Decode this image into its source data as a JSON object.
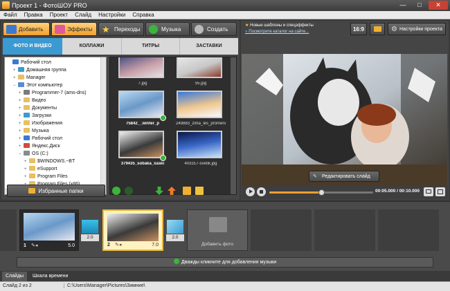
{
  "window": {
    "title": "Проект 1 - ФотоШОУ PRO",
    "min_glyph": "—",
    "max_glyph": "□",
    "close_glyph": "✕"
  },
  "menu": [
    "Файл",
    "Правка",
    "Проект",
    "Слайд",
    "Настройки",
    "Справка"
  ],
  "main_tabs": [
    {
      "label": "Добавить",
      "icon": "photos-icon",
      "active": true
    },
    {
      "label": "Эффекты",
      "icon": "magic-wand-icon",
      "active": true
    },
    {
      "label": "Переходы",
      "icon": "star-icon",
      "active": false
    },
    {
      "label": "Музыка",
      "icon": "music-note-icon",
      "active": false
    },
    {
      "label": "Создать",
      "icon": "film-reel-icon",
      "active": false
    }
  ],
  "sub_tabs": [
    "ФОТО И ВИДЕО",
    "КОЛЛАЖИ",
    "ТИТРЫ",
    "ЗАСТАВКИ"
  ],
  "tree": [
    {
      "label": "Рабочий стол",
      "level": 0,
      "exp": "",
      "color": "#3c7ad2"
    },
    {
      "label": "Домашняя группа",
      "level": 1,
      "exp": "+",
      "color": "#3c9ad2"
    },
    {
      "label": "Manager",
      "level": 1,
      "exp": "+",
      "color": "#e8c060"
    },
    {
      "label": "Этот компьютер",
      "level": 1,
      "exp": "−",
      "color": "#5a8ad2"
    },
    {
      "label": "Programmer-7 (ams-dns)",
      "level": 2,
      "exp": "+",
      "color": "#7a7a7a"
    },
    {
      "label": "Видео",
      "level": 2,
      "exp": "+",
      "color": "#e8c060"
    },
    {
      "label": "Документы",
      "level": 2,
      "exp": "+",
      "color": "#e8c060"
    },
    {
      "label": "Загрузки",
      "level": 2,
      "exp": "+",
      "color": "#3c9ad2"
    },
    {
      "label": "Изображения",
      "level": 2,
      "exp": "+",
      "color": "#e8c060"
    },
    {
      "label": "Музыка",
      "level": 2,
      "exp": "+",
      "color": "#e8c060"
    },
    {
      "label": "Рабочий стол",
      "level": 2,
      "exp": "+",
      "color": "#3c7ad2"
    },
    {
      "label": "Яндекс.Диск",
      "level": 2,
      "exp": "+",
      "color": "#d24a3c"
    },
    {
      "label": "OS (C:)",
      "level": 2,
      "exp": "−",
      "color": "#8a8a8a"
    },
    {
      "label": "$WINDOWS.~BT",
      "level": 3,
      "exp": "+",
      "color": "#e8c060"
    },
    {
      "label": "eSupport",
      "level": 3,
      "exp": "+",
      "color": "#e8c060"
    },
    {
      "label": "Program Files",
      "level": 3,
      "exp": "+",
      "color": "#e8c060"
    },
    {
      "label": "Program Files (x86)",
      "level": 3,
      "exp": "+",
      "color": "#e8c060"
    }
  ],
  "thumbnails": [
    {
      "caption": "7.jpg",
      "bold": false,
      "checked": false,
      "bg": "linear-gradient(160deg,#2a3a78,#c8a0a8 60%,#e8e0e8)"
    },
    {
      "caption": "55.jpg",
      "bold": false,
      "checked": false,
      "bg": "linear-gradient(160deg,#f0f0f0,#c8c8c8 60%,#8a3a2a)"
    },
    {
      "caption": "75842__winter_p",
      "bold": true,
      "checked": true,
      "bg": "linear-gradient(160deg,#b8d8f0,#6a98c8 50%,#e8e8f0)"
    },
    {
      "caption": "249883_zima_les_promeni",
      "bold": false,
      "checked": false,
      "bg": "linear-gradient(170deg,#3a78d8,#f0c890 55%,#f8f8ff)"
    },
    {
      "caption": "379435_sobaka_xaski",
      "bold": true,
      "checked": true,
      "bg": "linear-gradient(160deg,#f0f0f0,#3a3a3a 55%,#c89060)"
    },
    {
      "caption": "403317-svetik.jpg",
      "bold": false,
      "checked": false,
      "bg": "linear-gradient(170deg,#0a1848,#3a68c8 50%,#c8e0f8)"
    }
  ],
  "favorites_button": "Избранные папки",
  "news": {
    "line1": "Новые шаблоны и спецэффекты",
    "line2": "Посмотрите каталог на сайте..."
  },
  "aspect_ratio": "16:9",
  "settings_button": "Настройки проекта",
  "edit_slide_button": "Редактировать слайд",
  "player": {
    "time": "00:05.000 / 00:10.000",
    "progress": 0.5
  },
  "slides": [
    {
      "num": "1",
      "duration": "5.0",
      "selected": false
    },
    {
      "num": "2",
      "duration": "7.0",
      "selected": true
    }
  ],
  "transitions": [
    {
      "duration": "2.0"
    },
    {
      "duration": "2.0"
    }
  ],
  "add_photo_label": "Добавить фото",
  "music_hint": "Дважды кликните для добавления музыки",
  "bottom_tabs": [
    "Слайды",
    "Шкала времени"
  ],
  "status": {
    "slide": "Слайд 2 из 2",
    "path": "C:\\Users\\Manager\\Pictures\\Зимние\\"
  },
  "colors": {
    "accent_orange": "#f0a030",
    "accent_blue": "#3c9ad2",
    "selected_slide": "#e8b840"
  }
}
